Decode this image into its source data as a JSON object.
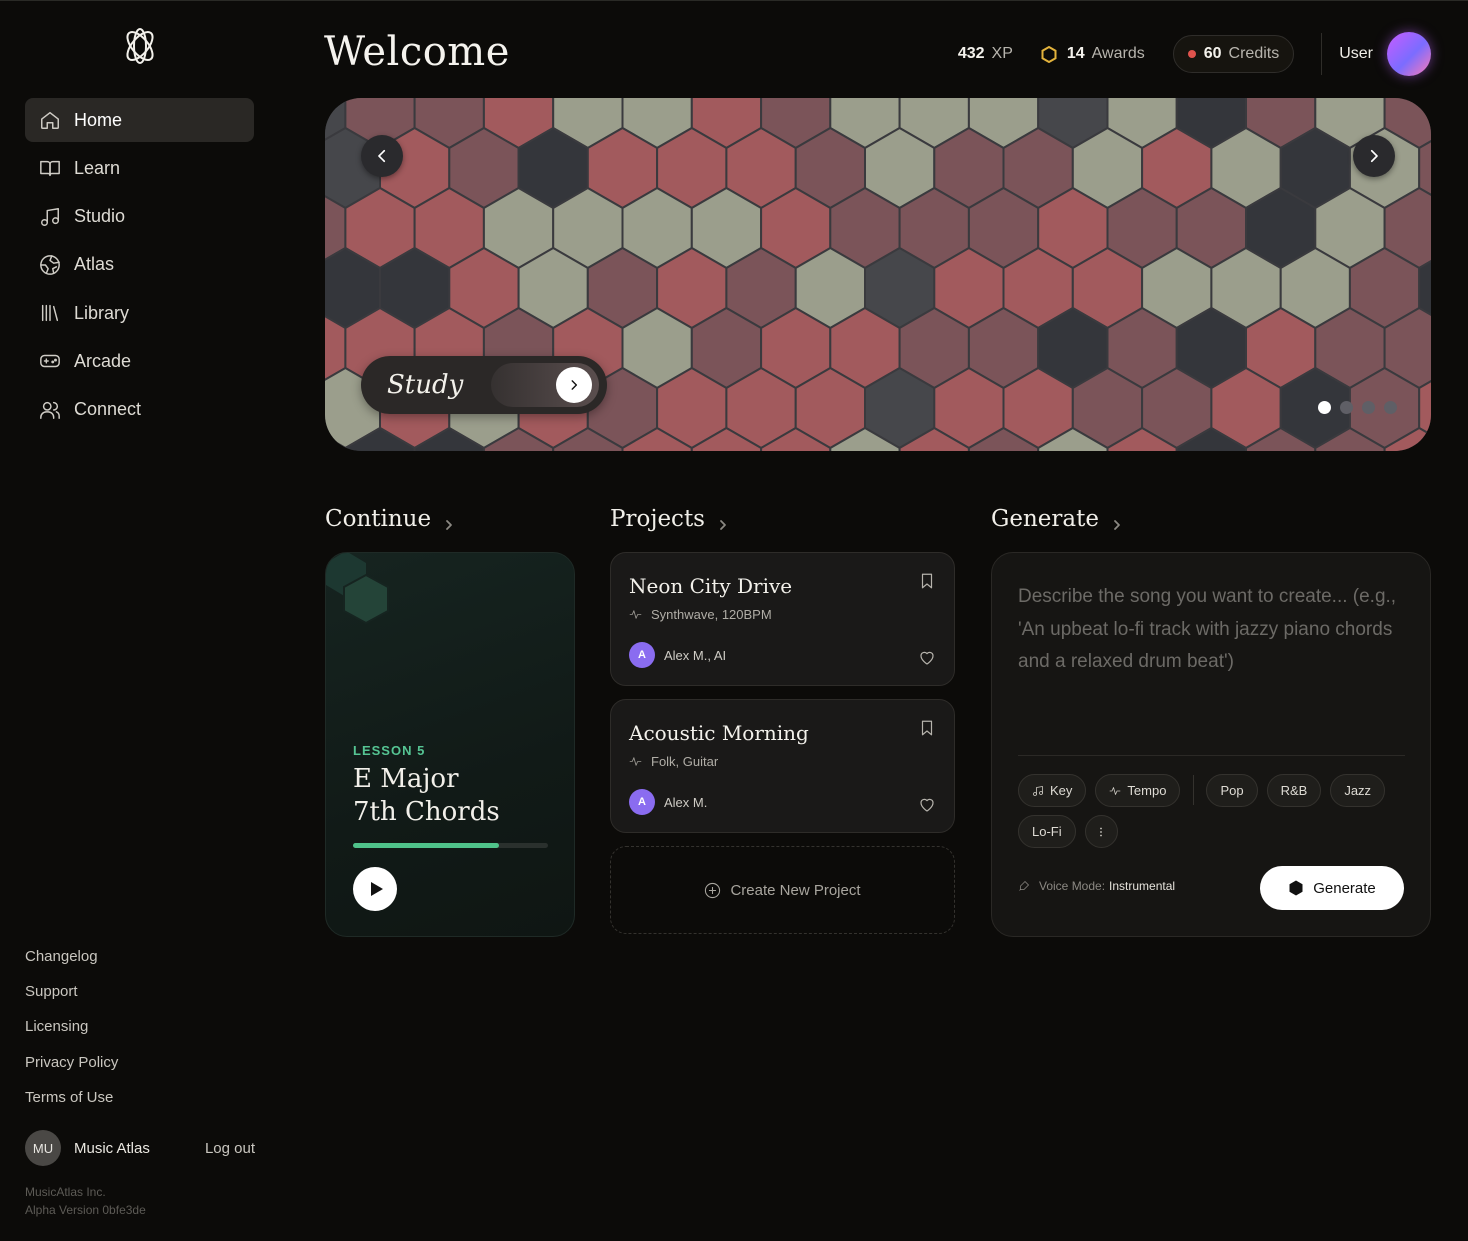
{
  "header": {
    "title": "Welcome",
    "xp_value": "432",
    "xp_label": "XP",
    "awards_value": "14",
    "awards_label": "Awards",
    "credits_value": "60",
    "credits_label": "Credits",
    "user_label": "User"
  },
  "sidebar": {
    "items": [
      {
        "label": "Home",
        "icon": "home-icon"
      },
      {
        "label": "Learn",
        "icon": "book-icon"
      },
      {
        "label": "Studio",
        "icon": "music-note-icon"
      },
      {
        "label": "Atlas",
        "icon": "globe-icon"
      },
      {
        "label": "Library",
        "icon": "library-icon"
      },
      {
        "label": "Arcade",
        "icon": "gamepad-icon"
      },
      {
        "label": "Connect",
        "icon": "users-icon"
      }
    ],
    "footer_links": [
      "Changelog",
      "Support",
      "Licensing",
      "Privacy Policy",
      "Terms of Use"
    ],
    "account_initials": "MU",
    "account_name": "Music Atlas",
    "logout_label": "Log out",
    "company": "MusicAtlas Inc.",
    "version": "Alpha Version 0bfe3de"
  },
  "hero": {
    "label": "Study",
    "slides_total": 4,
    "active_slide": 1,
    "colors": {
      "rose": "#a25a5d",
      "mauve": "#7b5459",
      "sage": "#9b9e8c",
      "slate": "#34363b",
      "grey": "#46474b"
    }
  },
  "continue": {
    "heading": "Continue",
    "lesson_tag": "LESSON 5",
    "lesson_title_line1": "E Major",
    "lesson_title_line2": "7th Chords",
    "progress": 0.75
  },
  "projects": {
    "heading": "Projects",
    "items": [
      {
        "title": "Neon City Drive",
        "meta": "Synthwave, 120BPM",
        "author_initial": "A",
        "authors": "Alex M., AI"
      },
      {
        "title": "Acoustic Morning",
        "meta": "Folk, Guitar",
        "author_initial": "A",
        "authors": "Alex M."
      }
    ],
    "create_label": "Create New Project"
  },
  "generate": {
    "heading": "Generate",
    "placeholder": "Describe the song you want to create... (e.g., 'An upbeat lo-fi track with jazzy piano chords and a relaxed drum beat')",
    "chips": {
      "key": "Key",
      "tempo": "Tempo",
      "pop": "Pop",
      "rnb": "R&B",
      "jazz": "Jazz",
      "lofi": "Lo-Fi"
    },
    "voice_mode_label": "Voice Mode:",
    "voice_mode_value": "Instrumental",
    "button_label": "Generate"
  }
}
